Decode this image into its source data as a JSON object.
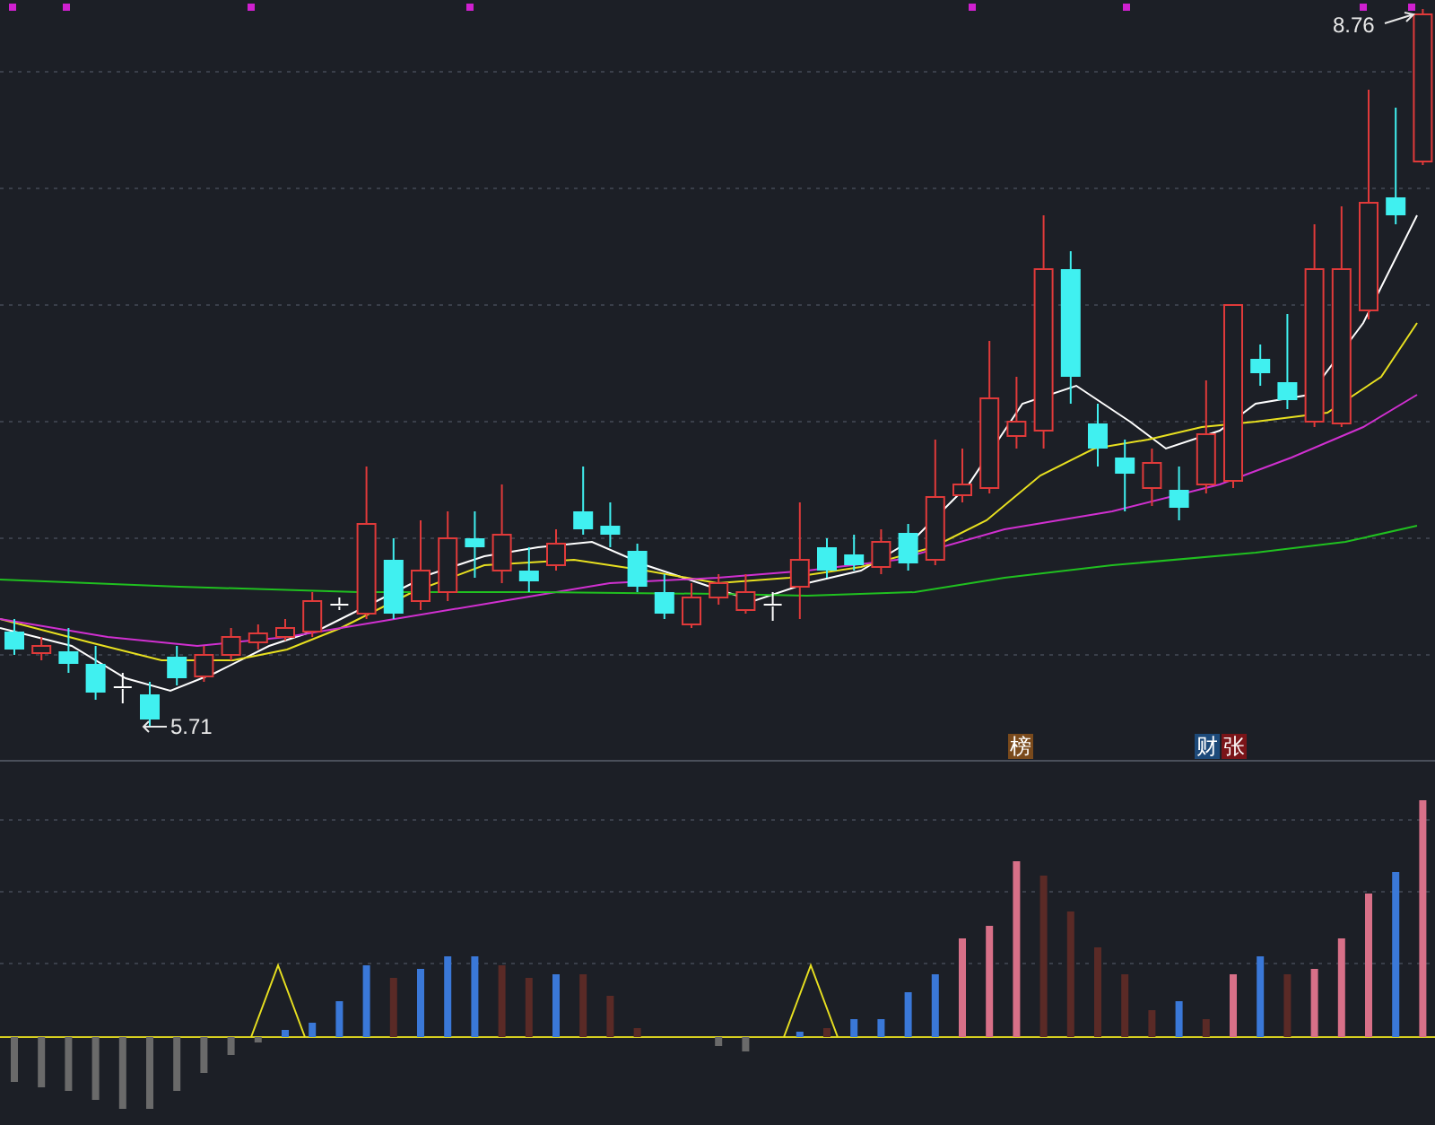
{
  "price_chart": {
    "high_label": "8.76",
    "low_label": "5.71"
  },
  "markers": [
    {
      "text": "榜",
      "color": "#7a4a1c"
    },
    {
      "text": "财",
      "color": "#1d4a7a"
    },
    {
      "text": "张",
      "color": "#7a1418"
    }
  ]
}
